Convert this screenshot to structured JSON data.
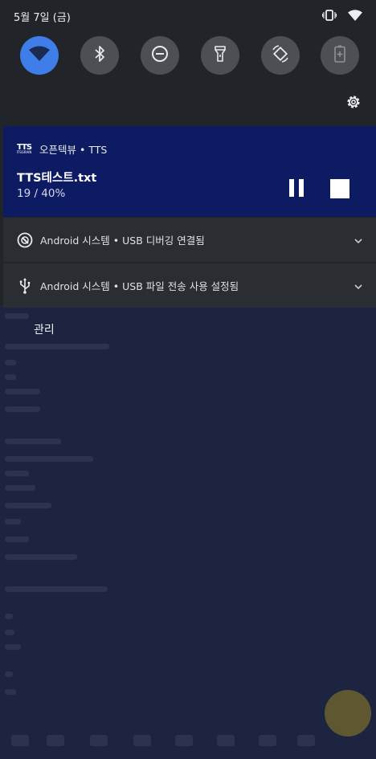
{
  "status_bar": {
    "date": "5월 7일 (금)",
    "icons": [
      "vibrate-icon",
      "wifi-signal-icon"
    ]
  },
  "quick_tiles": [
    {
      "name": "wifi",
      "icon": "wifi-icon",
      "active": true
    },
    {
      "name": "bluetooth",
      "icon": "bluetooth-icon",
      "active": false
    },
    {
      "name": "do-not-disturb",
      "icon": "do-not-disturb-icon",
      "active": false
    },
    {
      "name": "flashlight",
      "icon": "flashlight-icon",
      "active": false
    },
    {
      "name": "auto-rotate",
      "icon": "auto-rotate-icon",
      "active": false
    },
    {
      "name": "battery-saver",
      "icon": "battery-saver-icon",
      "active": false
    }
  ],
  "media": {
    "app_name": "오픈텍뷰 • TTS",
    "logo_text": "TTS",
    "logo_subtext": "ITSGRAIN",
    "title": "TTS테스트.txt",
    "progress": "19 / 40%",
    "background_color": "#0d1b63"
  },
  "notifications": [
    {
      "text": "Android 시스템 • USB 디버깅 연결됨",
      "icon": "usb-debug-icon"
    },
    {
      "text": "Android 시스템 • USB 파일 전송 사용 설정됨",
      "icon": "usb-icon"
    }
  ],
  "manage_label": "관리",
  "colors": {
    "accent": "#3f7ee8",
    "tile_inactive": "#4c4f54",
    "shade_background": "#212429"
  }
}
